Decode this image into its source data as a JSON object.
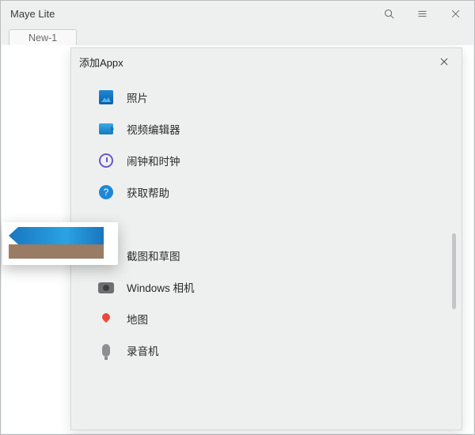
{
  "window": {
    "title": "Maye Lite"
  },
  "tabs": [
    {
      "label": "New-1"
    }
  ],
  "dialog": {
    "title": "添加Appx",
    "items": [
      {
        "label": "照片",
        "icon": "photos-icon"
      },
      {
        "label": "视频编辑器",
        "icon": "video-icon"
      },
      {
        "label": "闹钟和时钟",
        "icon": "clock-icon"
      },
      {
        "label": "获取帮助",
        "icon": "help-icon"
      },
      {
        "label": "",
        "icon": "hidden-icon"
      },
      {
        "label": "截图和草图",
        "icon": "snip-icon"
      },
      {
        "label": "Windows 相机",
        "icon": "camera-icon"
      },
      {
        "label": "地图",
        "icon": "map-icon"
      },
      {
        "label": "录音机",
        "icon": "mic-icon"
      }
    ]
  }
}
